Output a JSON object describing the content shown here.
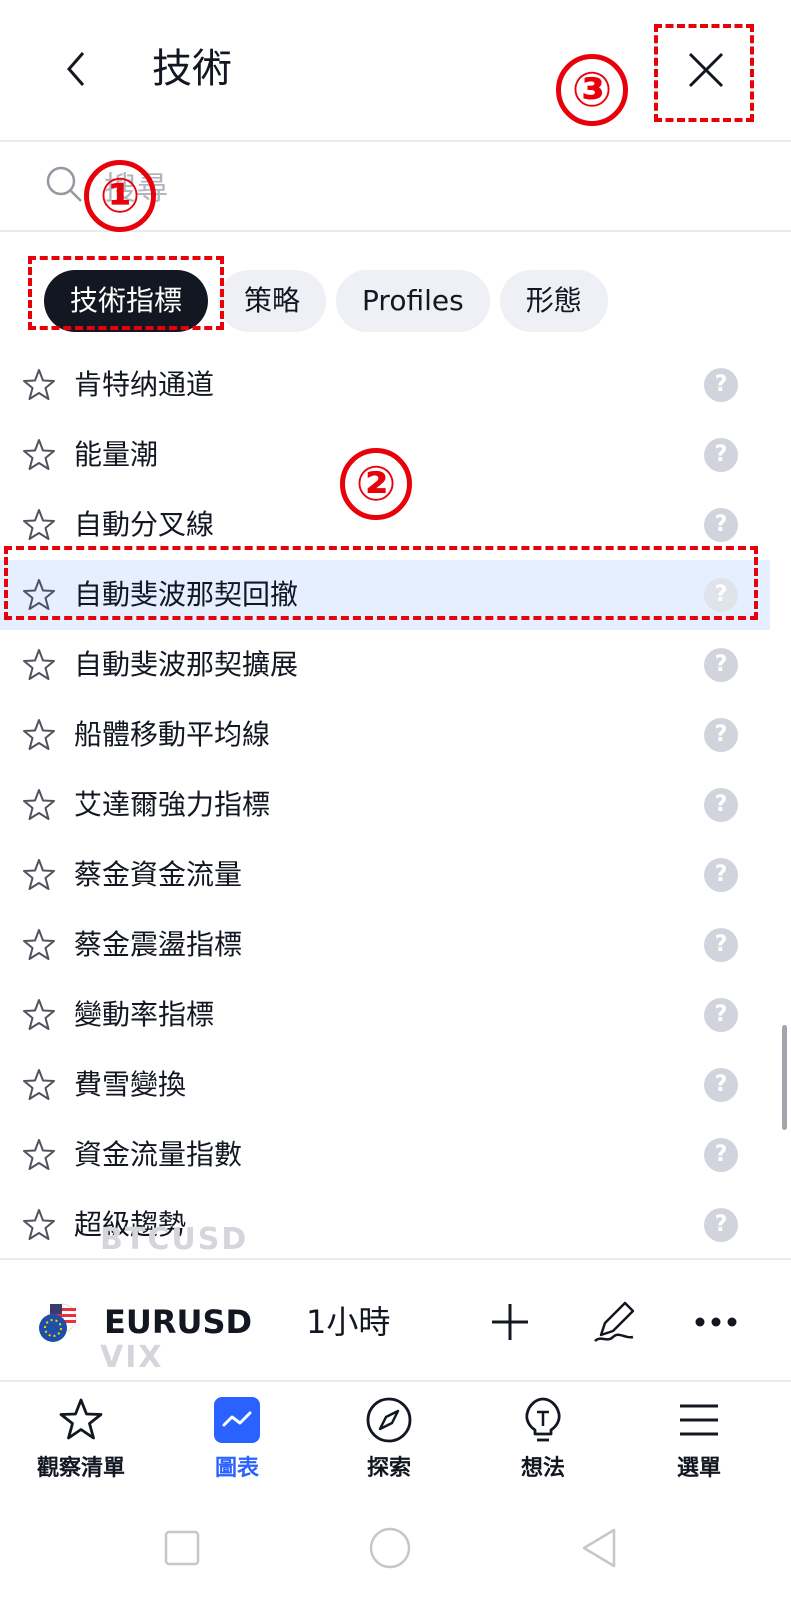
{
  "header": {
    "title": "技術",
    "back_icon": "chevron-left-icon",
    "close_icon": "close-icon"
  },
  "search": {
    "placeholder": "搜尋",
    "value": ""
  },
  "tabs": [
    {
      "label": "技術指標",
      "active": true
    },
    {
      "label": "策略",
      "active": false
    },
    {
      "label": "Profiles",
      "active": false
    },
    {
      "label": "形態",
      "active": false
    }
  ],
  "indicators": [
    {
      "name": "肯特纳通道",
      "highlighted": false
    },
    {
      "name": "能量潮",
      "highlighted": false
    },
    {
      "name": "自動分叉線",
      "highlighted": false
    },
    {
      "name": "自動斐波那契回撤",
      "highlighted": true
    },
    {
      "name": "自動斐波那契擴展",
      "highlighted": false
    },
    {
      "name": "船體移動平均線",
      "highlighted": false
    },
    {
      "name": "艾達爾強力指標",
      "highlighted": false
    },
    {
      "name": "蔡金資金流量",
      "highlighted": false
    },
    {
      "name": "蔡金震盪指標",
      "highlighted": false
    },
    {
      "name": "變動率指標",
      "highlighted": false
    },
    {
      "name": "費雪變換",
      "highlighted": false
    },
    {
      "name": "資金流量指數",
      "highlighted": false
    },
    {
      "name": "超級趨勢",
      "highlighted": false
    }
  ],
  "row_help_glyph": "?",
  "background_watchlist": [
    "BTCUSD",
    "VIX"
  ],
  "chart_toolbar": {
    "symbol": "EURUSD",
    "interval": "1小時",
    "icons": [
      "plus-icon",
      "pen-icon",
      "more-icon"
    ]
  },
  "bottom_nav": [
    {
      "label": "觀察清單",
      "icon": "star-icon",
      "active": false
    },
    {
      "label": "圖表",
      "icon": "chart-icon",
      "active": true
    },
    {
      "label": "探索",
      "icon": "compass-icon",
      "active": false
    },
    {
      "label": "想法",
      "icon": "lightbulb-icon",
      "active": false
    },
    {
      "label": "選單",
      "icon": "menu-icon",
      "active": false
    }
  ],
  "annotations": [
    "①",
    "②",
    "③"
  ],
  "colors": {
    "accent": "#2962ff",
    "annotation": "#e8000a",
    "active_tab": "#131722",
    "highlight_row": "#e5efff"
  }
}
